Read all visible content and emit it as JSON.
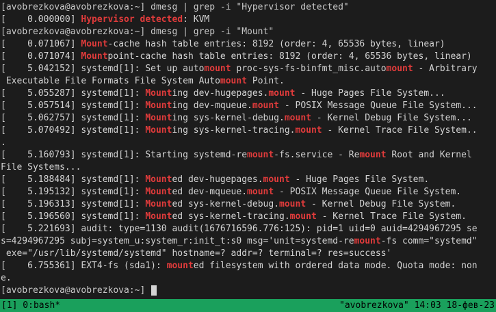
{
  "colors": {
    "background": "#1c1c1c",
    "text": "#d3d3d3",
    "match": "#e03b3b",
    "status_bar": "#1aa05c"
  },
  "terminal": {
    "lines": [
      [
        {
          "t": "[avobrezkova@avobrezkova:~] dmesg | grep -i \"Hypervisor detected\"",
          "c": "prompt"
        }
      ],
      [
        {
          "t": "[    0.000000] ",
          "c": ""
        },
        {
          "t": "Hypervisor detected",
          "c": "match"
        },
        {
          "t": ": KVM",
          "c": ""
        }
      ],
      [
        {
          "t": "[avobrezkova@avobrezkova:~] dmesg | grep -i \"Mount\"",
          "c": "prompt"
        }
      ],
      [
        {
          "t": "[    0.071067] ",
          "c": ""
        },
        {
          "t": "Mount",
          "c": "match"
        },
        {
          "t": "-cache hash table entries: 8192 (order: 4, 65536 bytes, linear)",
          "c": ""
        }
      ],
      [
        {
          "t": "[    0.071074] ",
          "c": ""
        },
        {
          "t": "Mount",
          "c": "match"
        },
        {
          "t": "point-cache hash table entries: 8192 (order: 4, 65536 bytes, linear)",
          "c": ""
        }
      ],
      [
        {
          "t": "[    5.042152] systemd[1]: Set up auto",
          "c": ""
        },
        {
          "t": "mount",
          "c": "match"
        },
        {
          "t": " proc-sys-fs-binfmt_misc.auto",
          "c": ""
        },
        {
          "t": "mount",
          "c": "match"
        },
        {
          "t": " - Arbitrary",
          "c": ""
        }
      ],
      [
        {
          "t": " Executable File Formats File System Auto",
          "c": ""
        },
        {
          "t": "mount",
          "c": "match"
        },
        {
          "t": " Point.",
          "c": ""
        }
      ],
      [
        {
          "t": "[    5.055287] systemd[1]: ",
          "c": ""
        },
        {
          "t": "Mount",
          "c": "match"
        },
        {
          "t": "ing dev-hugepages.",
          "c": ""
        },
        {
          "t": "mount",
          "c": "match"
        },
        {
          "t": " - Huge Pages File System...",
          "c": ""
        }
      ],
      [
        {
          "t": "[    5.057514] systemd[1]: ",
          "c": ""
        },
        {
          "t": "Mount",
          "c": "match"
        },
        {
          "t": "ing dev-mqueue.",
          "c": ""
        },
        {
          "t": "mount",
          "c": "match"
        },
        {
          "t": " - POSIX Message Queue File System...",
          "c": ""
        }
      ],
      [
        {
          "t": "[    5.062757] systemd[1]: ",
          "c": ""
        },
        {
          "t": "Mount",
          "c": "match"
        },
        {
          "t": "ing sys-kernel-debug.",
          "c": ""
        },
        {
          "t": "mount",
          "c": "match"
        },
        {
          "t": " - Kernel Debug File System...",
          "c": ""
        }
      ],
      [
        {
          "t": "[    5.070492] systemd[1]: ",
          "c": ""
        },
        {
          "t": "Mount",
          "c": "match"
        },
        {
          "t": "ing sys-kernel-tracing.",
          "c": ""
        },
        {
          "t": "mount",
          "c": "match"
        },
        {
          "t": " - Kernel Trace File System..",
          "c": ""
        }
      ],
      [
        {
          "t": ".",
          "c": ""
        }
      ],
      [
        {
          "t": "[    5.160793] systemd[1]: Starting systemd-re",
          "c": ""
        },
        {
          "t": "mount",
          "c": "match"
        },
        {
          "t": "-fs.service - Re",
          "c": ""
        },
        {
          "t": "mount",
          "c": "match"
        },
        {
          "t": " Root and Kernel",
          "c": ""
        }
      ],
      [
        {
          "t": "File Systems...",
          "c": ""
        }
      ],
      [
        {
          "t": "[    5.188484] systemd[1]: ",
          "c": ""
        },
        {
          "t": "Mount",
          "c": "match"
        },
        {
          "t": "ed dev-hugepages.",
          "c": ""
        },
        {
          "t": "mount",
          "c": "match"
        },
        {
          "t": " - Huge Pages File System.",
          "c": ""
        }
      ],
      [
        {
          "t": "[    5.195132] systemd[1]: ",
          "c": ""
        },
        {
          "t": "Mount",
          "c": "match"
        },
        {
          "t": "ed dev-mqueue.",
          "c": ""
        },
        {
          "t": "mount",
          "c": "match"
        },
        {
          "t": " - POSIX Message Queue File System.",
          "c": ""
        }
      ],
      [
        {
          "t": "[    5.196313] systemd[1]: ",
          "c": ""
        },
        {
          "t": "Mount",
          "c": "match"
        },
        {
          "t": "ed sys-kernel-debug.",
          "c": ""
        },
        {
          "t": "mount",
          "c": "match"
        },
        {
          "t": " - Kernel Debug File System.",
          "c": ""
        }
      ],
      [
        {
          "t": "[    5.196560] systemd[1]: ",
          "c": ""
        },
        {
          "t": "Mount",
          "c": "match"
        },
        {
          "t": "ed sys-kernel-tracing.",
          "c": ""
        },
        {
          "t": "mount",
          "c": "match"
        },
        {
          "t": " - Kernel Trace File System.",
          "c": ""
        }
      ],
      [
        {
          "t": "[    5.221693] audit: type=1130 audit(1676716596.776:125): pid=1 uid=0 auid=4294967295 se",
          "c": ""
        }
      ],
      [
        {
          "t": "s=4294967295 subj=system_u:system_r:init_t:s0 msg='unit=systemd-re",
          "c": ""
        },
        {
          "t": "mount",
          "c": "match"
        },
        {
          "t": "-fs comm=\"systemd\"",
          "c": ""
        }
      ],
      [
        {
          "t": " exe=\"/usr/lib/systemd/systemd\" hostname=? addr=? terminal=? res=success'",
          "c": ""
        }
      ],
      [
        {
          "t": "[    6.755361] EXT4-fs (sda1): ",
          "c": ""
        },
        {
          "t": "mount",
          "c": "match"
        },
        {
          "t": "ed filesystem with ordered data mode. Quota mode: non",
          "c": ""
        }
      ],
      [
        {
          "t": "e.",
          "c": ""
        }
      ],
      [
        {
          "t": "[avobrezkova@avobrezkova:~] ",
          "c": "prompt"
        }
      ]
    ]
  },
  "status_bar": {
    "left": "[1] 0:bash*",
    "right": "\"avobrezkova\" 14:03 18-фев-23"
  }
}
